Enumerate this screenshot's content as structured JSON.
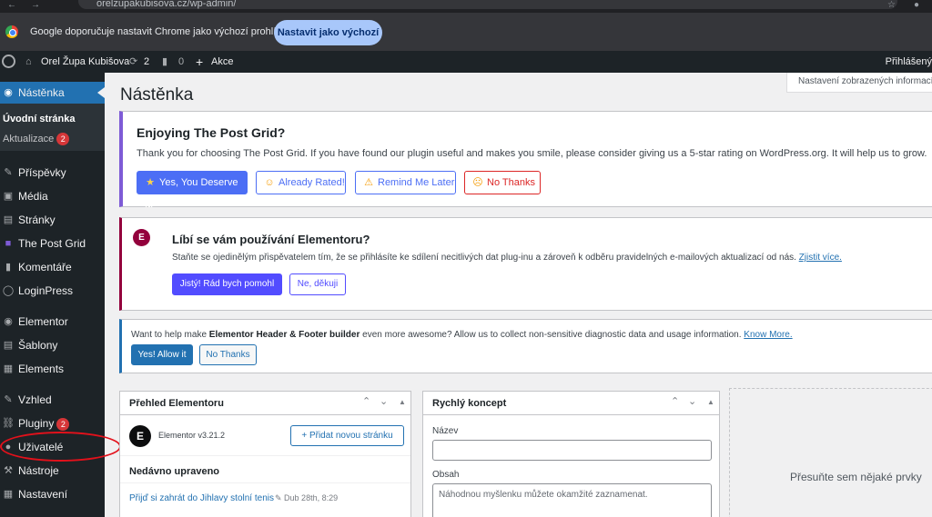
{
  "browser": {
    "url": "orelzupakubisova.cz/wp-admin/",
    "infobar_message": "Google doporučuje nastavit Chrome jako výchozí prohlížeč",
    "infobar_button": "Nastavit jako výchozí"
  },
  "adminbar": {
    "site_name": "Orel Župa Kubišova",
    "updates_count": "2",
    "comments_count": "0",
    "new_label": "Akce",
    "account": "Přihlášený"
  },
  "sidebar": {
    "dashboard": "Nástěnka",
    "sub_home": "Úvodní stránka",
    "sub_updates": "Aktualizace",
    "sub_updates_badge": "2",
    "items": [
      {
        "label": "Příspěvky",
        "icon": "pushpin-icon"
      },
      {
        "label": "Média",
        "icon": "media-icon"
      },
      {
        "label": "Stránky",
        "icon": "pages-icon"
      },
      {
        "label": "The Post Grid",
        "icon": "post-grid-icon"
      },
      {
        "label": "Komentáře",
        "icon": "comments-icon"
      },
      {
        "label": "LoginPress",
        "icon": "loginpress-icon"
      },
      {
        "label": "Elementor",
        "icon": "elementor-icon"
      },
      {
        "label": "Šablony",
        "icon": "templates-icon"
      },
      {
        "label": "Elements",
        "icon": "elements-icon"
      },
      {
        "label": "Vzhled",
        "icon": "appearance-icon"
      },
      {
        "label": "Pluginy",
        "icon": "plugins-icon",
        "badge": "2"
      },
      {
        "label": "Uživatelé",
        "icon": "users-icon"
      },
      {
        "label": "Nástroje",
        "icon": "tools-icon"
      },
      {
        "label": "Nastavení",
        "icon": "settings-icon"
      }
    ]
  },
  "page": {
    "title": "Nástěnka",
    "screen_options": "Nastavení zobrazených informací"
  },
  "post_grid_notice": {
    "title": "Enjoying The Post Grid?",
    "text": "Thank you for choosing The Post Grid. If you have found our plugin useful and makes you smile, please consider giving us a 5-star rating on WordPress.org. It will help us to grow.",
    "btn_yes": "Yes, You Deserve It!",
    "btn_rated": "Already Rated!",
    "btn_later": "Remind Me Later",
    "btn_no": "No Thanks"
  },
  "elementor_notice": {
    "title": "Líbí se vám používání Elementoru?",
    "text": "Staňte se ojedinělým přispěvatelem tím, že se přihlásíte ke sdílení necitlivých dat plug-inu a zároveň k odběru pravidelných e-mailových aktualizací od nás.",
    "link": "Zjistit více.",
    "btn_yes": "Jistý! Rád bych pomohl",
    "btn_no": "Ne, děkuji"
  },
  "hf_notice": {
    "text_before": "Want to help make ",
    "text_bold": "Elementor Header & Footer builder",
    "text_after": " even more awesome? Allow us to collect non-sensitive diagnostic data and usage information.",
    "link": "Know More.",
    "btn_yes": "Yes! Allow it",
    "btn_no": "No Thanks"
  },
  "elementor_overview": {
    "title": "Přehled Elementoru",
    "version": "Elementor v3.21.2",
    "add_page": "Přidat novou stránku",
    "recent_title": "Nedávno upraveno",
    "recent_post": "Přijď si zahrát do Jihlavy stolní tenis",
    "recent_date": "Dub 28th, 8:29"
  },
  "quick_draft": {
    "title": "Rychlý koncept",
    "title_label": "Název",
    "title_value": "",
    "content_label": "Obsah",
    "content_placeholder": "Náhodnou myšlenku můžete okamžité zaznamenat."
  },
  "dropzone": {
    "text": "Přesuňte sem nějaké prvky"
  },
  "colors": {
    "wp_blue": "#2271b1",
    "admin_dark": "#1d2327",
    "post_grid_accent": "#7e5bd6",
    "elementor_accent": "#93003c",
    "highlight_circle": "#e3111b"
  }
}
